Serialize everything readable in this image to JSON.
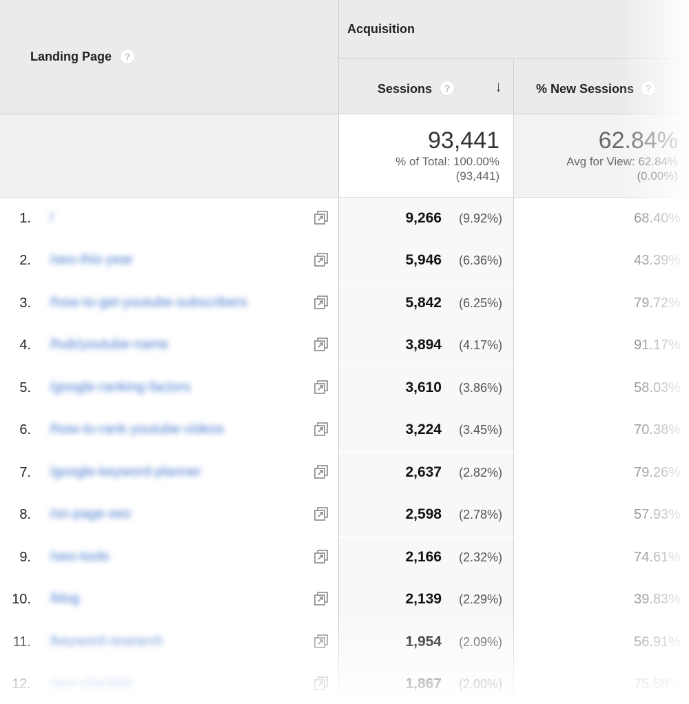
{
  "header": {
    "landing_page_label": "Landing Page",
    "help_glyph": "?",
    "acquisition_label": "Acquisition",
    "sessions_label": "Sessions",
    "sort_glyph": "↓",
    "new_sessions_label": "% New Sessions"
  },
  "totals": {
    "sessions_value": "93,441",
    "sessions_pct_line": "% of Total: 100.00%",
    "sessions_paren": "(93,441)",
    "new_sessions_value": "62.84%",
    "new_sessions_avg_line": "Avg for View: 62.84%",
    "new_sessions_paren": "(0.00%)"
  },
  "icons": {
    "help": "help-circle-icon",
    "sort": "sort-desc-arrow-icon",
    "external": "open-in-new-icon"
  },
  "colors": {
    "link": "#4a7bd0",
    "header_bg": "#ebebeb"
  },
  "rows": [
    {
      "num": "1.",
      "page": "/",
      "sessions": "9,266",
      "pct": "(9.92%)",
      "new": "68.40%"
    },
    {
      "num": "2.",
      "page": "/seo-this-year",
      "sessions": "5,946",
      "pct": "(6.36%)",
      "new": "43.39%"
    },
    {
      "num": "3.",
      "page": "/how-to-get-youtube-subscribers",
      "sessions": "5,842",
      "pct": "(6.25%)",
      "new": "79.72%"
    },
    {
      "num": "4.",
      "page": "/hub/youtube-name",
      "sessions": "3,894",
      "pct": "(4.17%)",
      "new": "91.17%"
    },
    {
      "num": "5.",
      "page": "/google-ranking-factors",
      "sessions": "3,610",
      "pct": "(3.86%)",
      "new": "58.03%"
    },
    {
      "num": "6.",
      "page": "/how-to-rank-youtube-videos",
      "sessions": "3,224",
      "pct": "(3.45%)",
      "new": "70.38%"
    },
    {
      "num": "7.",
      "page": "/google-keyword-planner",
      "sessions": "2,637",
      "pct": "(2.82%)",
      "new": "79.26%"
    },
    {
      "num": "8.",
      "page": "/on-page-seo",
      "sessions": "2,598",
      "pct": "(2.78%)",
      "new": "57.93%"
    },
    {
      "num": "9.",
      "page": "/seo-tools",
      "sessions": "2,166",
      "pct": "(2.32%)",
      "new": "74.61%"
    },
    {
      "num": "10.",
      "page": "/blog",
      "sessions": "2,139",
      "pct": "(2.29%)",
      "new": "39.83%"
    },
    {
      "num": "11.",
      "page": "/keyword-research",
      "sessions": "1,954",
      "pct": "(2.09%)",
      "new": "56.91%"
    },
    {
      "num": "12.",
      "page": "/seo-checklist",
      "sessions": "1,867",
      "pct": "(2.00%)",
      "new": "75.58%"
    }
  ]
}
